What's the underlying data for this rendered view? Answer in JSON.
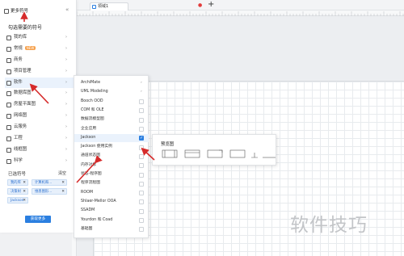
{
  "tabbar": {
    "tab_label": "领域1",
    "add_label": "+"
  },
  "toolbar": {
    "more_label": "更多符号",
    "title": "勾选需要的符号"
  },
  "sidebar": {
    "categories": [
      {
        "label": "我的库",
        "badge": ""
      },
      {
        "label": "常规",
        "badge": "NEW"
      },
      {
        "label": "商务",
        "badge": ""
      },
      {
        "label": "项目管理",
        "badge": ""
      },
      {
        "label": "软件",
        "badge": ""
      },
      {
        "label": "数据库图",
        "badge": ""
      },
      {
        "label": "房屋平面图",
        "badge": ""
      },
      {
        "label": "网络图",
        "badge": ""
      },
      {
        "label": "云服务",
        "badge": ""
      },
      {
        "label": "工程",
        "badge": ""
      },
      {
        "label": "线框图",
        "badge": ""
      },
      {
        "label": "科学",
        "badge": ""
      }
    ]
  },
  "selected": {
    "title": "已选符号",
    "clear_label": "清空",
    "chips": [
      "我的库",
      "计算机和...",
      "决策树",
      "维恩图形...",
      "Jackson"
    ],
    "more_button": "获取更多"
  },
  "submenu": {
    "items": [
      {
        "label": "ArchiMate",
        "type": "arrow"
      },
      {
        "label": "UML Modeling",
        "type": "arrow"
      },
      {
        "label": "Booch OOD",
        "type": "checkbox"
      },
      {
        "label": "COM 和 OLE",
        "type": "checkbox"
      },
      {
        "label": "数据流模型图",
        "type": "checkbox"
      },
      {
        "label": "企业应用",
        "type": "checkbox"
      },
      {
        "label": "Jackson",
        "type": "checked"
      },
      {
        "label": "Jackson 使用实例",
        "type": "checkbox"
      },
      {
        "label": "通道状态图",
        "type": "checkbox"
      },
      {
        "label": "内存对象",
        "type": "checkbox"
      },
      {
        "label": "状态-程序图",
        "type": "checkbox"
      },
      {
        "label": "程序流程图",
        "type": "checkbox"
      },
      {
        "label": "ROOM",
        "type": "checkbox"
      },
      {
        "label": "Shlaer-Mellor OOA",
        "type": "checkbox"
      },
      {
        "label": "SSADM",
        "type": "checkbox"
      },
      {
        "label": "Yourdon 和 Coad",
        "type": "checkbox"
      },
      {
        "label": "基础图",
        "type": "checkbox"
      }
    ]
  },
  "preview": {
    "title": "预览图"
  },
  "watermark": "软件技巧",
  "colors": {
    "accent": "#2b7fe0",
    "arrow": "#d62b2b",
    "chip_bg": "#e7f0fb"
  }
}
